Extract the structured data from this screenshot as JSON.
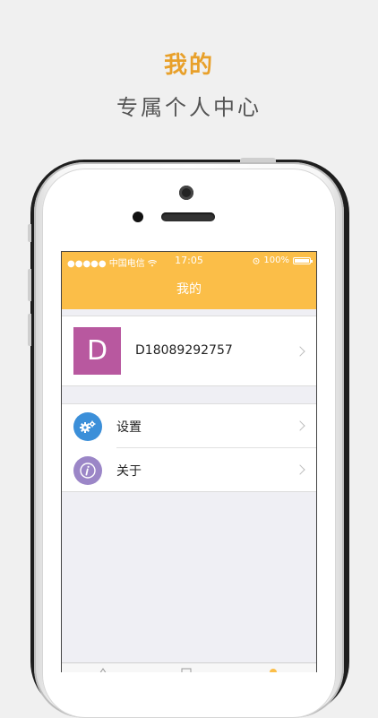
{
  "promo": {
    "title": "我的",
    "subtitle": "专属个人中心"
  },
  "status_bar": {
    "carrier": "●●●●● 中国电信 ",
    "time": "17:05",
    "battery_text": "100%"
  },
  "nav": {
    "title": "我的"
  },
  "profile": {
    "avatar_letter": "D",
    "username": "D18089292757"
  },
  "menu": {
    "settings_label": "设置",
    "about_label": "关于"
  },
  "colors": {
    "accent": "#fbbe48",
    "promo_title": "#e8a02a",
    "avatar": "#b8589f",
    "settings_icon": "#3b8fd9",
    "about_icon": "#9b86c7"
  }
}
